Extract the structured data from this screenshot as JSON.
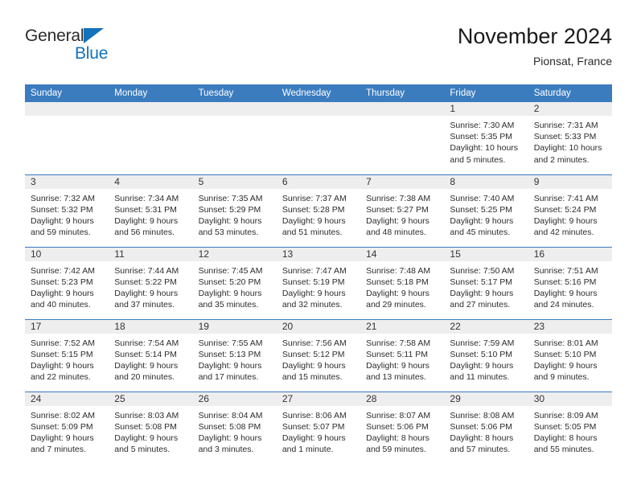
{
  "logo": {
    "word1": "General",
    "word2": "Blue",
    "triangle_color": "#1272bc"
  },
  "header": {
    "title": "November 2024",
    "subtitle": "Pionsat, France",
    "accent_color": "#3b7cbf",
    "daynum_bg": "#eeeeee"
  },
  "weekday_headers": [
    "Sunday",
    "Monday",
    "Tuesday",
    "Wednesday",
    "Thursday",
    "Friday",
    "Saturday"
  ],
  "labels": {
    "sunrise": "Sunrise:",
    "sunset": "Sunset:",
    "daylight": "Daylight:"
  },
  "weeks": [
    [
      {
        "empty": true
      },
      {
        "empty": true
      },
      {
        "empty": true
      },
      {
        "empty": true
      },
      {
        "empty": true
      },
      {
        "day": "1",
        "sunrise": "Sunrise: 7:30 AM",
        "sunset": "Sunset: 5:35 PM",
        "daylight_l1": "Daylight: 10 hours",
        "daylight_l2": "and 5 minutes."
      },
      {
        "day": "2",
        "sunrise": "Sunrise: 7:31 AM",
        "sunset": "Sunset: 5:33 PM",
        "daylight_l1": "Daylight: 10 hours",
        "daylight_l2": "and 2 minutes."
      }
    ],
    [
      {
        "day": "3",
        "sunrise": "Sunrise: 7:32 AM",
        "sunset": "Sunset: 5:32 PM",
        "daylight_l1": "Daylight: 9 hours",
        "daylight_l2": "and 59 minutes."
      },
      {
        "day": "4",
        "sunrise": "Sunrise: 7:34 AM",
        "sunset": "Sunset: 5:31 PM",
        "daylight_l1": "Daylight: 9 hours",
        "daylight_l2": "and 56 minutes."
      },
      {
        "day": "5",
        "sunrise": "Sunrise: 7:35 AM",
        "sunset": "Sunset: 5:29 PM",
        "daylight_l1": "Daylight: 9 hours",
        "daylight_l2": "and 53 minutes."
      },
      {
        "day": "6",
        "sunrise": "Sunrise: 7:37 AM",
        "sunset": "Sunset: 5:28 PM",
        "daylight_l1": "Daylight: 9 hours",
        "daylight_l2": "and 51 minutes."
      },
      {
        "day": "7",
        "sunrise": "Sunrise: 7:38 AM",
        "sunset": "Sunset: 5:27 PM",
        "daylight_l1": "Daylight: 9 hours",
        "daylight_l2": "and 48 minutes."
      },
      {
        "day": "8",
        "sunrise": "Sunrise: 7:40 AM",
        "sunset": "Sunset: 5:25 PM",
        "daylight_l1": "Daylight: 9 hours",
        "daylight_l2": "and 45 minutes."
      },
      {
        "day": "9",
        "sunrise": "Sunrise: 7:41 AM",
        "sunset": "Sunset: 5:24 PM",
        "daylight_l1": "Daylight: 9 hours",
        "daylight_l2": "and 42 minutes."
      }
    ],
    [
      {
        "day": "10",
        "sunrise": "Sunrise: 7:42 AM",
        "sunset": "Sunset: 5:23 PM",
        "daylight_l1": "Daylight: 9 hours",
        "daylight_l2": "and 40 minutes."
      },
      {
        "day": "11",
        "sunrise": "Sunrise: 7:44 AM",
        "sunset": "Sunset: 5:22 PM",
        "daylight_l1": "Daylight: 9 hours",
        "daylight_l2": "and 37 minutes."
      },
      {
        "day": "12",
        "sunrise": "Sunrise: 7:45 AM",
        "sunset": "Sunset: 5:20 PM",
        "daylight_l1": "Daylight: 9 hours",
        "daylight_l2": "and 35 minutes."
      },
      {
        "day": "13",
        "sunrise": "Sunrise: 7:47 AM",
        "sunset": "Sunset: 5:19 PM",
        "daylight_l1": "Daylight: 9 hours",
        "daylight_l2": "and 32 minutes."
      },
      {
        "day": "14",
        "sunrise": "Sunrise: 7:48 AM",
        "sunset": "Sunset: 5:18 PM",
        "daylight_l1": "Daylight: 9 hours",
        "daylight_l2": "and 29 minutes."
      },
      {
        "day": "15",
        "sunrise": "Sunrise: 7:50 AM",
        "sunset": "Sunset: 5:17 PM",
        "daylight_l1": "Daylight: 9 hours",
        "daylight_l2": "and 27 minutes."
      },
      {
        "day": "16",
        "sunrise": "Sunrise: 7:51 AM",
        "sunset": "Sunset: 5:16 PM",
        "daylight_l1": "Daylight: 9 hours",
        "daylight_l2": "and 24 minutes."
      }
    ],
    [
      {
        "day": "17",
        "sunrise": "Sunrise: 7:52 AM",
        "sunset": "Sunset: 5:15 PM",
        "daylight_l1": "Daylight: 9 hours",
        "daylight_l2": "and 22 minutes."
      },
      {
        "day": "18",
        "sunrise": "Sunrise: 7:54 AM",
        "sunset": "Sunset: 5:14 PM",
        "daylight_l1": "Daylight: 9 hours",
        "daylight_l2": "and 20 minutes."
      },
      {
        "day": "19",
        "sunrise": "Sunrise: 7:55 AM",
        "sunset": "Sunset: 5:13 PM",
        "daylight_l1": "Daylight: 9 hours",
        "daylight_l2": "and 17 minutes."
      },
      {
        "day": "20",
        "sunrise": "Sunrise: 7:56 AM",
        "sunset": "Sunset: 5:12 PM",
        "daylight_l1": "Daylight: 9 hours",
        "daylight_l2": "and 15 minutes."
      },
      {
        "day": "21",
        "sunrise": "Sunrise: 7:58 AM",
        "sunset": "Sunset: 5:11 PM",
        "daylight_l1": "Daylight: 9 hours",
        "daylight_l2": "and 13 minutes."
      },
      {
        "day": "22",
        "sunrise": "Sunrise: 7:59 AM",
        "sunset": "Sunset: 5:10 PM",
        "daylight_l1": "Daylight: 9 hours",
        "daylight_l2": "and 11 minutes."
      },
      {
        "day": "23",
        "sunrise": "Sunrise: 8:01 AM",
        "sunset": "Sunset: 5:10 PM",
        "daylight_l1": "Daylight: 9 hours",
        "daylight_l2": "and 9 minutes."
      }
    ],
    [
      {
        "day": "24",
        "sunrise": "Sunrise: 8:02 AM",
        "sunset": "Sunset: 5:09 PM",
        "daylight_l1": "Daylight: 9 hours",
        "daylight_l2": "and 7 minutes."
      },
      {
        "day": "25",
        "sunrise": "Sunrise: 8:03 AM",
        "sunset": "Sunset: 5:08 PM",
        "daylight_l1": "Daylight: 9 hours",
        "daylight_l2": "and 5 minutes."
      },
      {
        "day": "26",
        "sunrise": "Sunrise: 8:04 AM",
        "sunset": "Sunset: 5:08 PM",
        "daylight_l1": "Daylight: 9 hours",
        "daylight_l2": "and 3 minutes."
      },
      {
        "day": "27",
        "sunrise": "Sunrise: 8:06 AM",
        "sunset": "Sunset: 5:07 PM",
        "daylight_l1": "Daylight: 9 hours",
        "daylight_l2": "and 1 minute."
      },
      {
        "day": "28",
        "sunrise": "Sunrise: 8:07 AM",
        "sunset": "Sunset: 5:06 PM",
        "daylight_l1": "Daylight: 8 hours",
        "daylight_l2": "and 59 minutes."
      },
      {
        "day": "29",
        "sunrise": "Sunrise: 8:08 AM",
        "sunset": "Sunset: 5:06 PM",
        "daylight_l1": "Daylight: 8 hours",
        "daylight_l2": "and 57 minutes."
      },
      {
        "day": "30",
        "sunrise": "Sunrise: 8:09 AM",
        "sunset": "Sunset: 5:05 PM",
        "daylight_l1": "Daylight: 8 hours",
        "daylight_l2": "and 55 minutes."
      }
    ]
  ]
}
